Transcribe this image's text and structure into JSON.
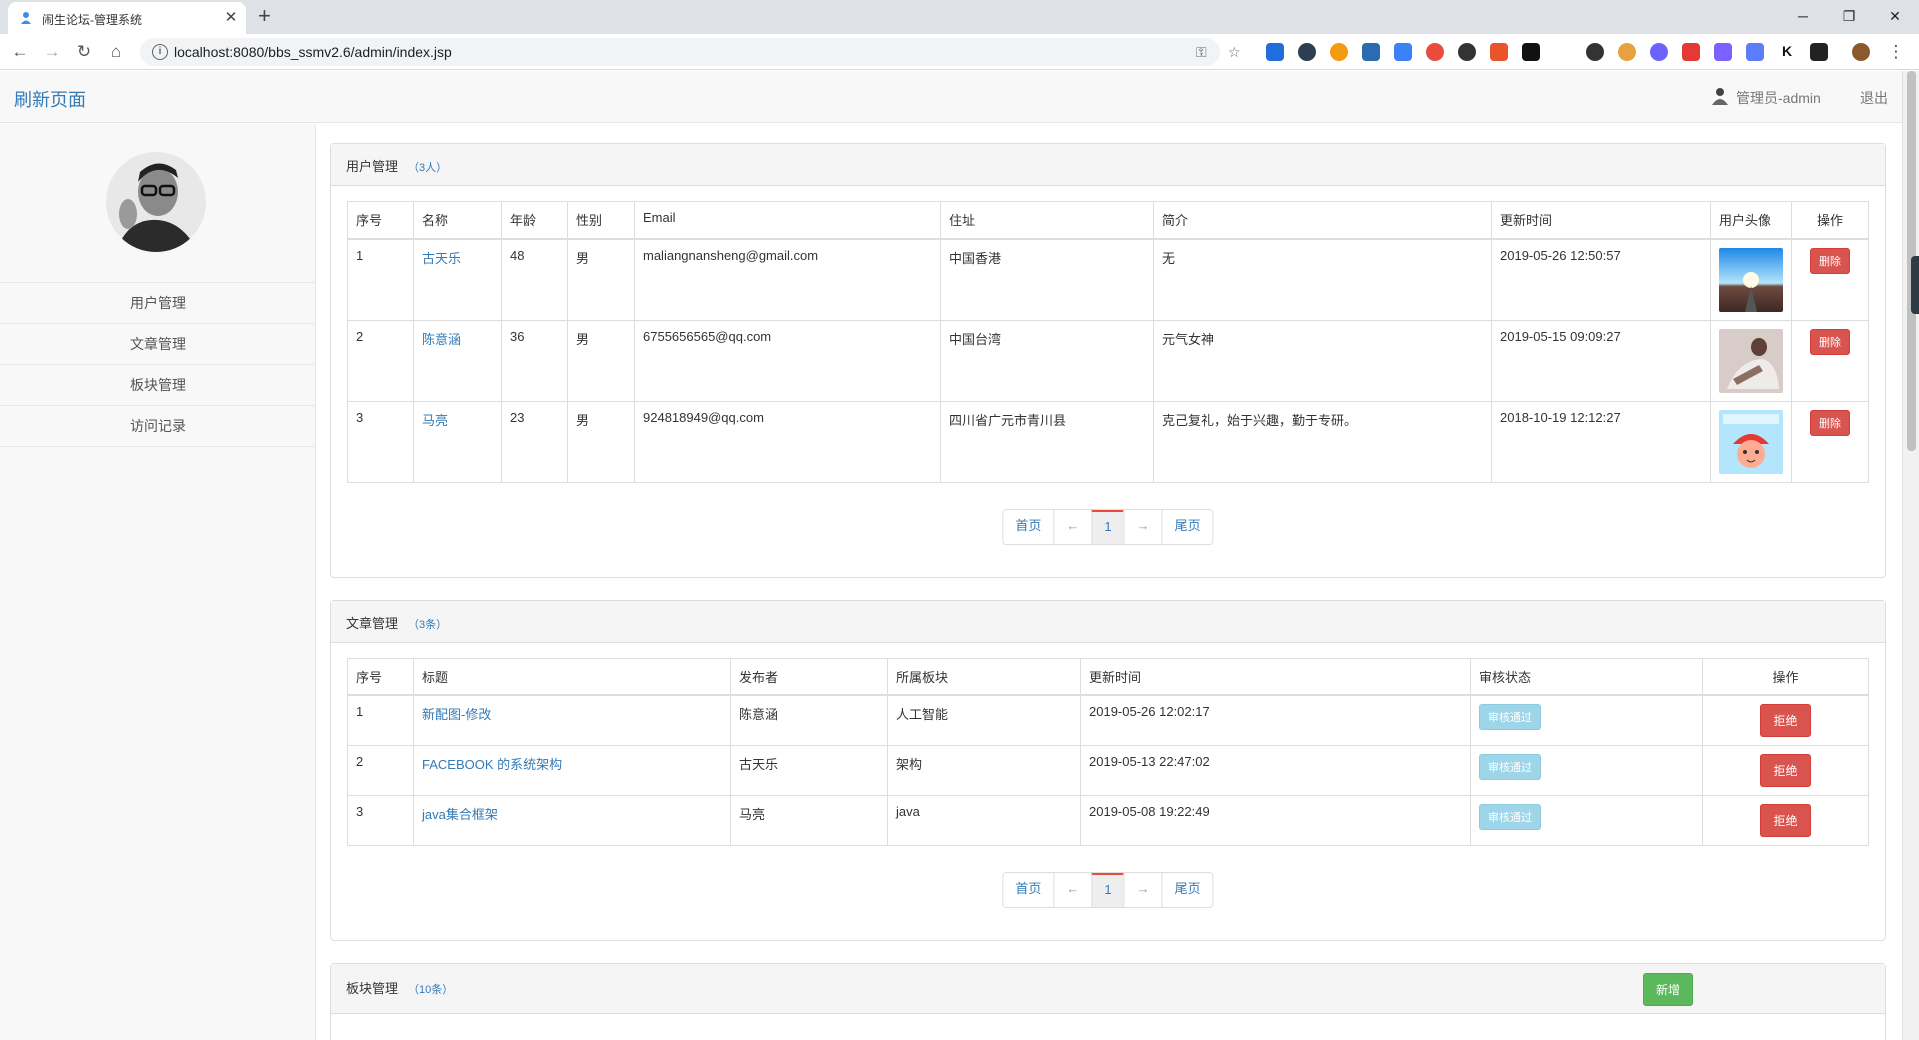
{
  "browser": {
    "tab_title": "闹生论坛-管理系统",
    "url": "localhost:8080/bbs_ssmv2.6/admin/index.jsp"
  },
  "header": {
    "brand": "刷新页面",
    "user_label": "管理员-admin",
    "logout": "退出"
  },
  "sidebar": {
    "items": [
      {
        "label": "用户管理"
      },
      {
        "label": "文章管理"
      },
      {
        "label": "板块管理"
      },
      {
        "label": "访问记录"
      }
    ]
  },
  "users": {
    "title": "用户管理",
    "count": "（3人）",
    "columns": [
      "序号",
      "名称",
      "年龄",
      "性别",
      "Email",
      "住址",
      "简介",
      "更新时间",
      "用户头像",
      "操作"
    ],
    "rows": [
      {
        "no": "1",
        "name": "古天乐",
        "age": "48",
        "gender": "男",
        "email": "maliangnansheng@gmail.com",
        "address": "中国香港",
        "intro": "无",
        "updated": "2019-05-26 12:50:57",
        "action": "删除"
      },
      {
        "no": "2",
        "name": "陈意涵",
        "age": "36",
        "gender": "男",
        "email": "6755656565@qq.com",
        "address": "中国台湾",
        "intro": "元气女神",
        "updated": "2019-05-15 09:09:27",
        "action": "删除"
      },
      {
        "no": "3",
        "name": "马亮",
        "age": "23",
        "gender": "男",
        "email": "924818949@qq.com",
        "address": "四川省广元市青川县",
        "intro": "克己复礼，始于兴趣，勤于专研。",
        "updated": "2018-10-19 12:12:27",
        "action": "删除"
      }
    ]
  },
  "posts": {
    "title": "文章管理",
    "count": "（3条）",
    "columns": [
      "序号",
      "标题",
      "发布者",
      "所属板块",
      "更新时间",
      "审核状态",
      "操作"
    ],
    "rows": [
      {
        "no": "1",
        "title": "新配图-修改",
        "author": "陈意涵",
        "board": "人工智能",
        "updated": "2019-05-26 12:02:17",
        "status": "审核通过",
        "action": "拒绝"
      },
      {
        "no": "2",
        "title": "FACEBOOK 的系统架构",
        "author": "古天乐",
        "board": "架构",
        "updated": "2019-05-13 22:47:02",
        "status": "审核通过",
        "action": "拒绝"
      },
      {
        "no": "3",
        "title": "java集合框架",
        "author": "马亮",
        "board": "java",
        "updated": "2019-05-08 19:22:49",
        "status": "审核通过",
        "action": "拒绝"
      }
    ]
  },
  "boards": {
    "title": "板块管理",
    "count": "（10条）",
    "add_button": "新增"
  },
  "pagination": {
    "first": "首页",
    "prev": "←",
    "current": "1",
    "next": "→",
    "last": "尾页"
  },
  "colors": {
    "link": "#337ab7",
    "danger": "#d9534f",
    "info": "#9fd5e8",
    "success": "#5cb85c"
  }
}
